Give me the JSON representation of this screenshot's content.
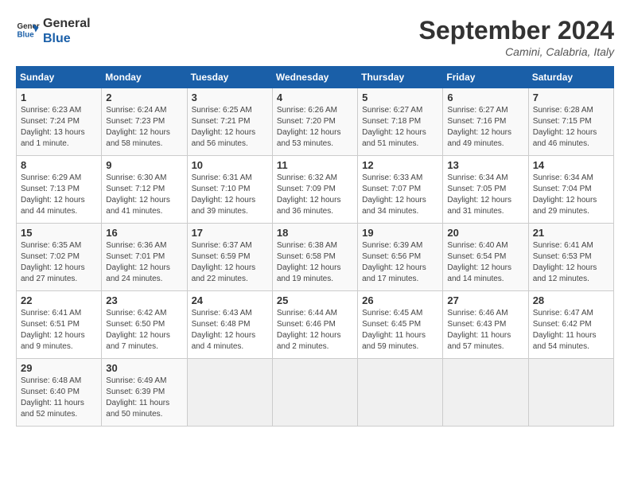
{
  "header": {
    "logo_line1": "General",
    "logo_line2": "Blue",
    "month": "September 2024",
    "location": "Camini, Calabria, Italy"
  },
  "weekdays": [
    "Sunday",
    "Monday",
    "Tuesday",
    "Wednesday",
    "Thursday",
    "Friday",
    "Saturday"
  ],
  "weeks": [
    [
      {
        "day": "1",
        "info": "Sunrise: 6:23 AM\nSunset: 7:24 PM\nDaylight: 13 hours\nand 1 minute."
      },
      {
        "day": "2",
        "info": "Sunrise: 6:24 AM\nSunset: 7:23 PM\nDaylight: 12 hours\nand 58 minutes."
      },
      {
        "day": "3",
        "info": "Sunrise: 6:25 AM\nSunset: 7:21 PM\nDaylight: 12 hours\nand 56 minutes."
      },
      {
        "day": "4",
        "info": "Sunrise: 6:26 AM\nSunset: 7:20 PM\nDaylight: 12 hours\nand 53 minutes."
      },
      {
        "day": "5",
        "info": "Sunrise: 6:27 AM\nSunset: 7:18 PM\nDaylight: 12 hours\nand 51 minutes."
      },
      {
        "day": "6",
        "info": "Sunrise: 6:27 AM\nSunset: 7:16 PM\nDaylight: 12 hours\nand 49 minutes."
      },
      {
        "day": "7",
        "info": "Sunrise: 6:28 AM\nSunset: 7:15 PM\nDaylight: 12 hours\nand 46 minutes."
      }
    ],
    [
      {
        "day": "8",
        "info": "Sunrise: 6:29 AM\nSunset: 7:13 PM\nDaylight: 12 hours\nand 44 minutes."
      },
      {
        "day": "9",
        "info": "Sunrise: 6:30 AM\nSunset: 7:12 PM\nDaylight: 12 hours\nand 41 minutes."
      },
      {
        "day": "10",
        "info": "Sunrise: 6:31 AM\nSunset: 7:10 PM\nDaylight: 12 hours\nand 39 minutes."
      },
      {
        "day": "11",
        "info": "Sunrise: 6:32 AM\nSunset: 7:09 PM\nDaylight: 12 hours\nand 36 minutes."
      },
      {
        "day": "12",
        "info": "Sunrise: 6:33 AM\nSunset: 7:07 PM\nDaylight: 12 hours\nand 34 minutes."
      },
      {
        "day": "13",
        "info": "Sunrise: 6:34 AM\nSunset: 7:05 PM\nDaylight: 12 hours\nand 31 minutes."
      },
      {
        "day": "14",
        "info": "Sunrise: 6:34 AM\nSunset: 7:04 PM\nDaylight: 12 hours\nand 29 minutes."
      }
    ],
    [
      {
        "day": "15",
        "info": "Sunrise: 6:35 AM\nSunset: 7:02 PM\nDaylight: 12 hours\nand 27 minutes."
      },
      {
        "day": "16",
        "info": "Sunrise: 6:36 AM\nSunset: 7:01 PM\nDaylight: 12 hours\nand 24 minutes."
      },
      {
        "day": "17",
        "info": "Sunrise: 6:37 AM\nSunset: 6:59 PM\nDaylight: 12 hours\nand 22 minutes."
      },
      {
        "day": "18",
        "info": "Sunrise: 6:38 AM\nSunset: 6:58 PM\nDaylight: 12 hours\nand 19 minutes."
      },
      {
        "day": "19",
        "info": "Sunrise: 6:39 AM\nSunset: 6:56 PM\nDaylight: 12 hours\nand 17 minutes."
      },
      {
        "day": "20",
        "info": "Sunrise: 6:40 AM\nSunset: 6:54 PM\nDaylight: 12 hours\nand 14 minutes."
      },
      {
        "day": "21",
        "info": "Sunrise: 6:41 AM\nSunset: 6:53 PM\nDaylight: 12 hours\nand 12 minutes."
      }
    ],
    [
      {
        "day": "22",
        "info": "Sunrise: 6:41 AM\nSunset: 6:51 PM\nDaylight: 12 hours\nand 9 minutes."
      },
      {
        "day": "23",
        "info": "Sunrise: 6:42 AM\nSunset: 6:50 PM\nDaylight: 12 hours\nand 7 minutes."
      },
      {
        "day": "24",
        "info": "Sunrise: 6:43 AM\nSunset: 6:48 PM\nDaylight: 12 hours\nand 4 minutes."
      },
      {
        "day": "25",
        "info": "Sunrise: 6:44 AM\nSunset: 6:46 PM\nDaylight: 12 hours\nand 2 minutes."
      },
      {
        "day": "26",
        "info": "Sunrise: 6:45 AM\nSunset: 6:45 PM\nDaylight: 11 hours\nand 59 minutes."
      },
      {
        "day": "27",
        "info": "Sunrise: 6:46 AM\nSunset: 6:43 PM\nDaylight: 11 hours\nand 57 minutes."
      },
      {
        "day": "28",
        "info": "Sunrise: 6:47 AM\nSunset: 6:42 PM\nDaylight: 11 hours\nand 54 minutes."
      }
    ],
    [
      {
        "day": "29",
        "info": "Sunrise: 6:48 AM\nSunset: 6:40 PM\nDaylight: 11 hours\nand 52 minutes."
      },
      {
        "day": "30",
        "info": "Sunrise: 6:49 AM\nSunset: 6:39 PM\nDaylight: 11 hours\nand 50 minutes."
      },
      {
        "day": "",
        "info": ""
      },
      {
        "day": "",
        "info": ""
      },
      {
        "day": "",
        "info": ""
      },
      {
        "day": "",
        "info": ""
      },
      {
        "day": "",
        "info": ""
      }
    ]
  ]
}
